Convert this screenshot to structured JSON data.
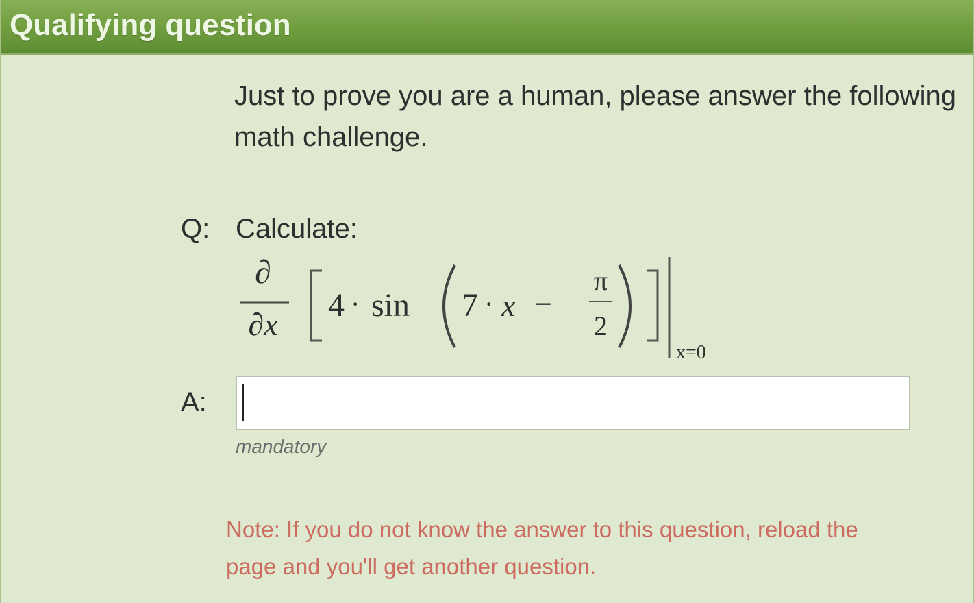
{
  "panel": {
    "title": "Qualifying question",
    "intro": "Just to prove you are a human, please answer the following math challenge.",
    "question_label": "Q:",
    "question_text": "Calculate:",
    "formula": {
      "partial_numerator": "∂",
      "partial_denominator": "∂x",
      "coefficient": "4",
      "dot": "·",
      "function": "sin",
      "inner_coefficient": "7",
      "variable": "x",
      "minus": "−",
      "pi": "π",
      "two": "2",
      "evaluation": "x=0"
    },
    "answer_label": "A:",
    "answer_value": "",
    "answer_placeholder": "",
    "mandatory_text": "mandatory",
    "note": "Note: If you do not know the answer to this question, reload the page and you'll get another question."
  },
  "colors": {
    "titlebar": "#6f9d3e",
    "background": "#dfe9cf",
    "note": "#cc6b5f"
  }
}
